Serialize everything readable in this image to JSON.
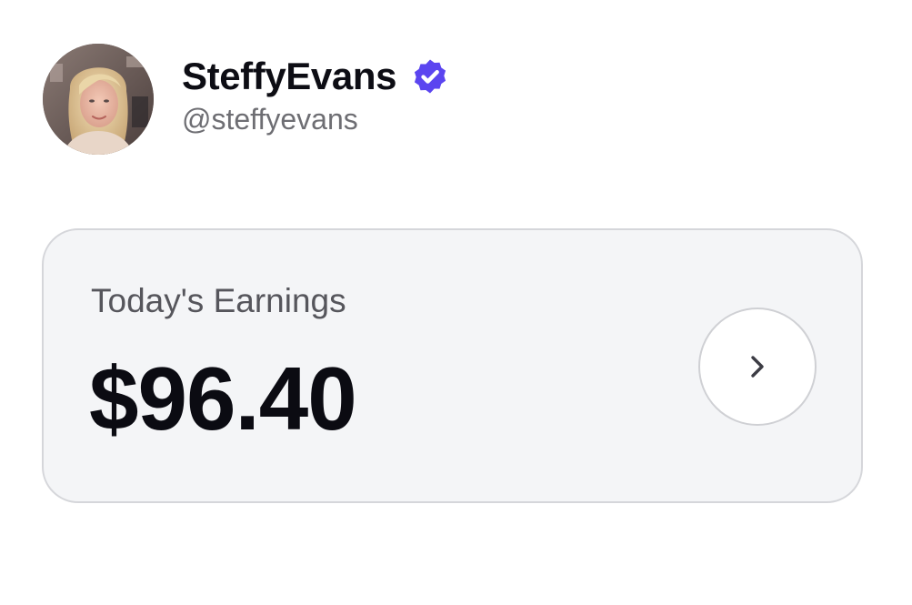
{
  "profile": {
    "display_name": "SteffyEvans",
    "handle": "@steffyevans",
    "verified": true,
    "avatar_icon": "user-avatar-photo",
    "badge_icon": "verified-badge-icon"
  },
  "earnings": {
    "label": "Today's Earnings",
    "amount": "$96.40",
    "action_icon": "chevron-right-icon"
  },
  "colors": {
    "badge": "#5b45f0",
    "card_background": "#f4f5f7",
    "card_border": "#d5d6da",
    "primary_text": "#0d0d14",
    "secondary_text": "#6e6e73"
  }
}
